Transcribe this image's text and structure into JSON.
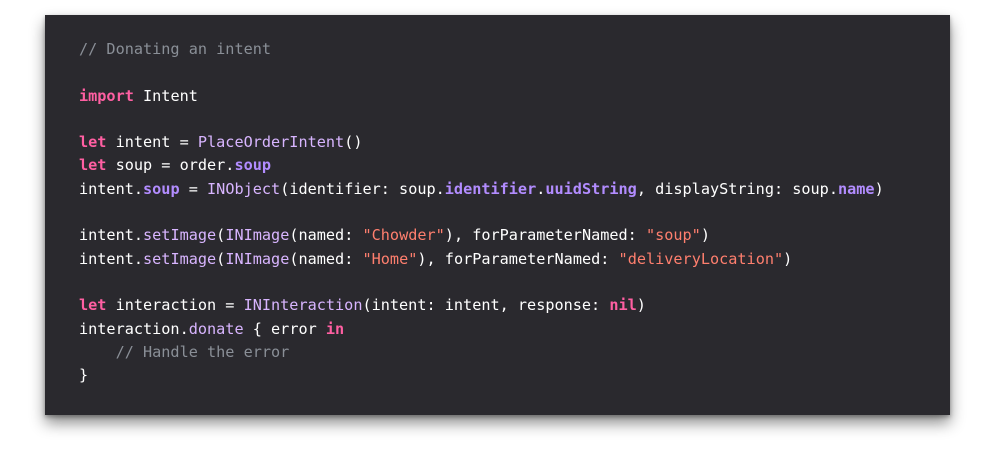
{
  "code": {
    "language": "swift",
    "lines": [
      [
        {
          "t": "// Donating an intent",
          "k": "comment"
        }
      ],
      [],
      [
        {
          "t": "import",
          "k": "keyword"
        },
        {
          "t": " Intent",
          "k": "plain"
        }
      ],
      [],
      [
        {
          "t": "let",
          "k": "keyword"
        },
        {
          "t": " intent = ",
          "k": "plain"
        },
        {
          "t": "PlaceOrderIntent",
          "k": "type"
        },
        {
          "t": "()",
          "k": "plain"
        }
      ],
      [
        {
          "t": "let",
          "k": "keyword"
        },
        {
          "t": " soup = order.",
          "k": "plain"
        },
        {
          "t": "soup",
          "k": "member"
        }
      ],
      [
        {
          "t": "intent.",
          "k": "plain"
        },
        {
          "t": "soup",
          "k": "member"
        },
        {
          "t": " = ",
          "k": "plain"
        },
        {
          "t": "INObject",
          "k": "type"
        },
        {
          "t": "(identifier: soup.",
          "k": "plain"
        },
        {
          "t": "identifier",
          "k": "member"
        },
        {
          "t": ".",
          "k": "plain"
        },
        {
          "t": "uuidString",
          "k": "member"
        },
        {
          "t": ", displayString: soup.",
          "k": "plain"
        },
        {
          "t": "name",
          "k": "member"
        },
        {
          "t": ")",
          "k": "plain"
        }
      ],
      [],
      [
        {
          "t": "intent.",
          "k": "plain"
        },
        {
          "t": "setImage",
          "k": "type"
        },
        {
          "t": "(",
          "k": "plain"
        },
        {
          "t": "INImage",
          "k": "type"
        },
        {
          "t": "(named: ",
          "k": "plain"
        },
        {
          "t": "\"Chowder\"",
          "k": "string"
        },
        {
          "t": "), forParameterNamed: ",
          "k": "plain"
        },
        {
          "t": "\"soup\"",
          "k": "string"
        },
        {
          "t": ")",
          "k": "plain"
        }
      ],
      [
        {
          "t": "intent.",
          "k": "plain"
        },
        {
          "t": "setImage",
          "k": "type"
        },
        {
          "t": "(",
          "k": "plain"
        },
        {
          "t": "INImage",
          "k": "type"
        },
        {
          "t": "(named: ",
          "k": "plain"
        },
        {
          "t": "\"Home\"",
          "k": "string"
        },
        {
          "t": "), forParameterNamed: ",
          "k": "plain"
        },
        {
          "t": "\"deliveryLocation\"",
          "k": "string"
        },
        {
          "t": ")",
          "k": "plain"
        }
      ],
      [],
      [
        {
          "t": "let",
          "k": "keyword"
        },
        {
          "t": " interaction = ",
          "k": "plain"
        },
        {
          "t": "INInteraction",
          "k": "type"
        },
        {
          "t": "(intent: intent, response: ",
          "k": "plain"
        },
        {
          "t": "nil",
          "k": "keyword"
        },
        {
          "t": ")",
          "k": "plain"
        }
      ],
      [
        {
          "t": "interaction.",
          "k": "plain"
        },
        {
          "t": "donate",
          "k": "type"
        },
        {
          "t": " { error ",
          "k": "plain"
        },
        {
          "t": "in",
          "k": "keyword"
        }
      ],
      [
        {
          "t": "    // Handle the error",
          "k": "comment"
        }
      ],
      [
        {
          "t": "}",
          "k": "plain"
        }
      ]
    ]
  },
  "colors": {
    "background": "#2a292e",
    "plain": "#ffffff",
    "comment": "#8a8f97",
    "keyword": "#ff5fa2",
    "type": "#d8b5ff",
    "member": "#b28cff",
    "string": "#ff7f6e"
  }
}
